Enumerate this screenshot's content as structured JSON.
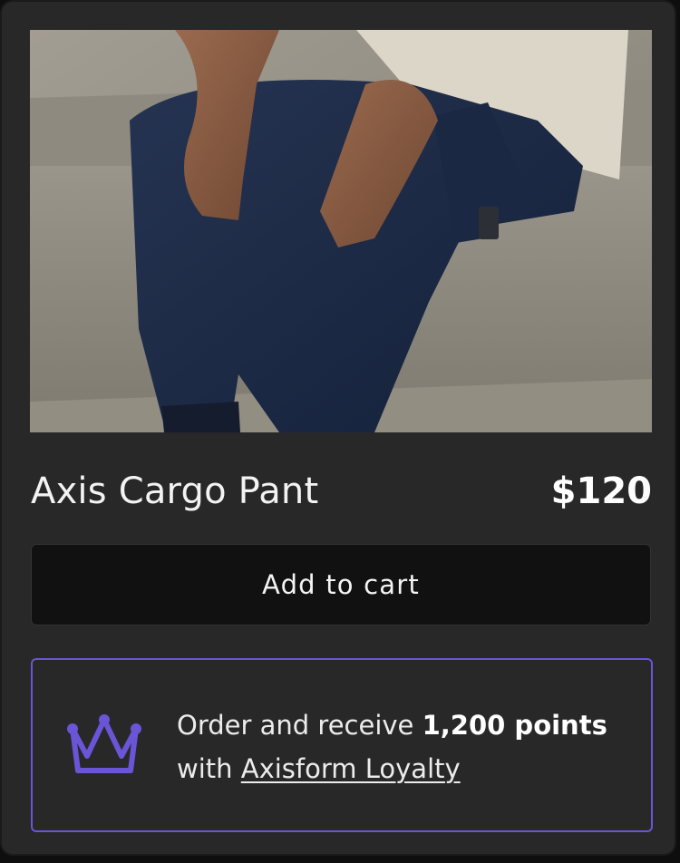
{
  "product": {
    "name": "Axis Cargo Pant",
    "price": "$120",
    "image_subject": "person seated on concrete wearing navy cargo jogger pants"
  },
  "actions": {
    "add_to_cart_label": "Add to cart"
  },
  "loyalty": {
    "lead_text": "Order and receive ",
    "points": "1,200 points",
    "with_text": "with ",
    "program_link": "Axisform Loyalty",
    "crown_icon": "crown-icon"
  },
  "colors": {
    "card_bg": "#282828",
    "button_bg": "#111111",
    "accent": "#6a55d6"
  }
}
